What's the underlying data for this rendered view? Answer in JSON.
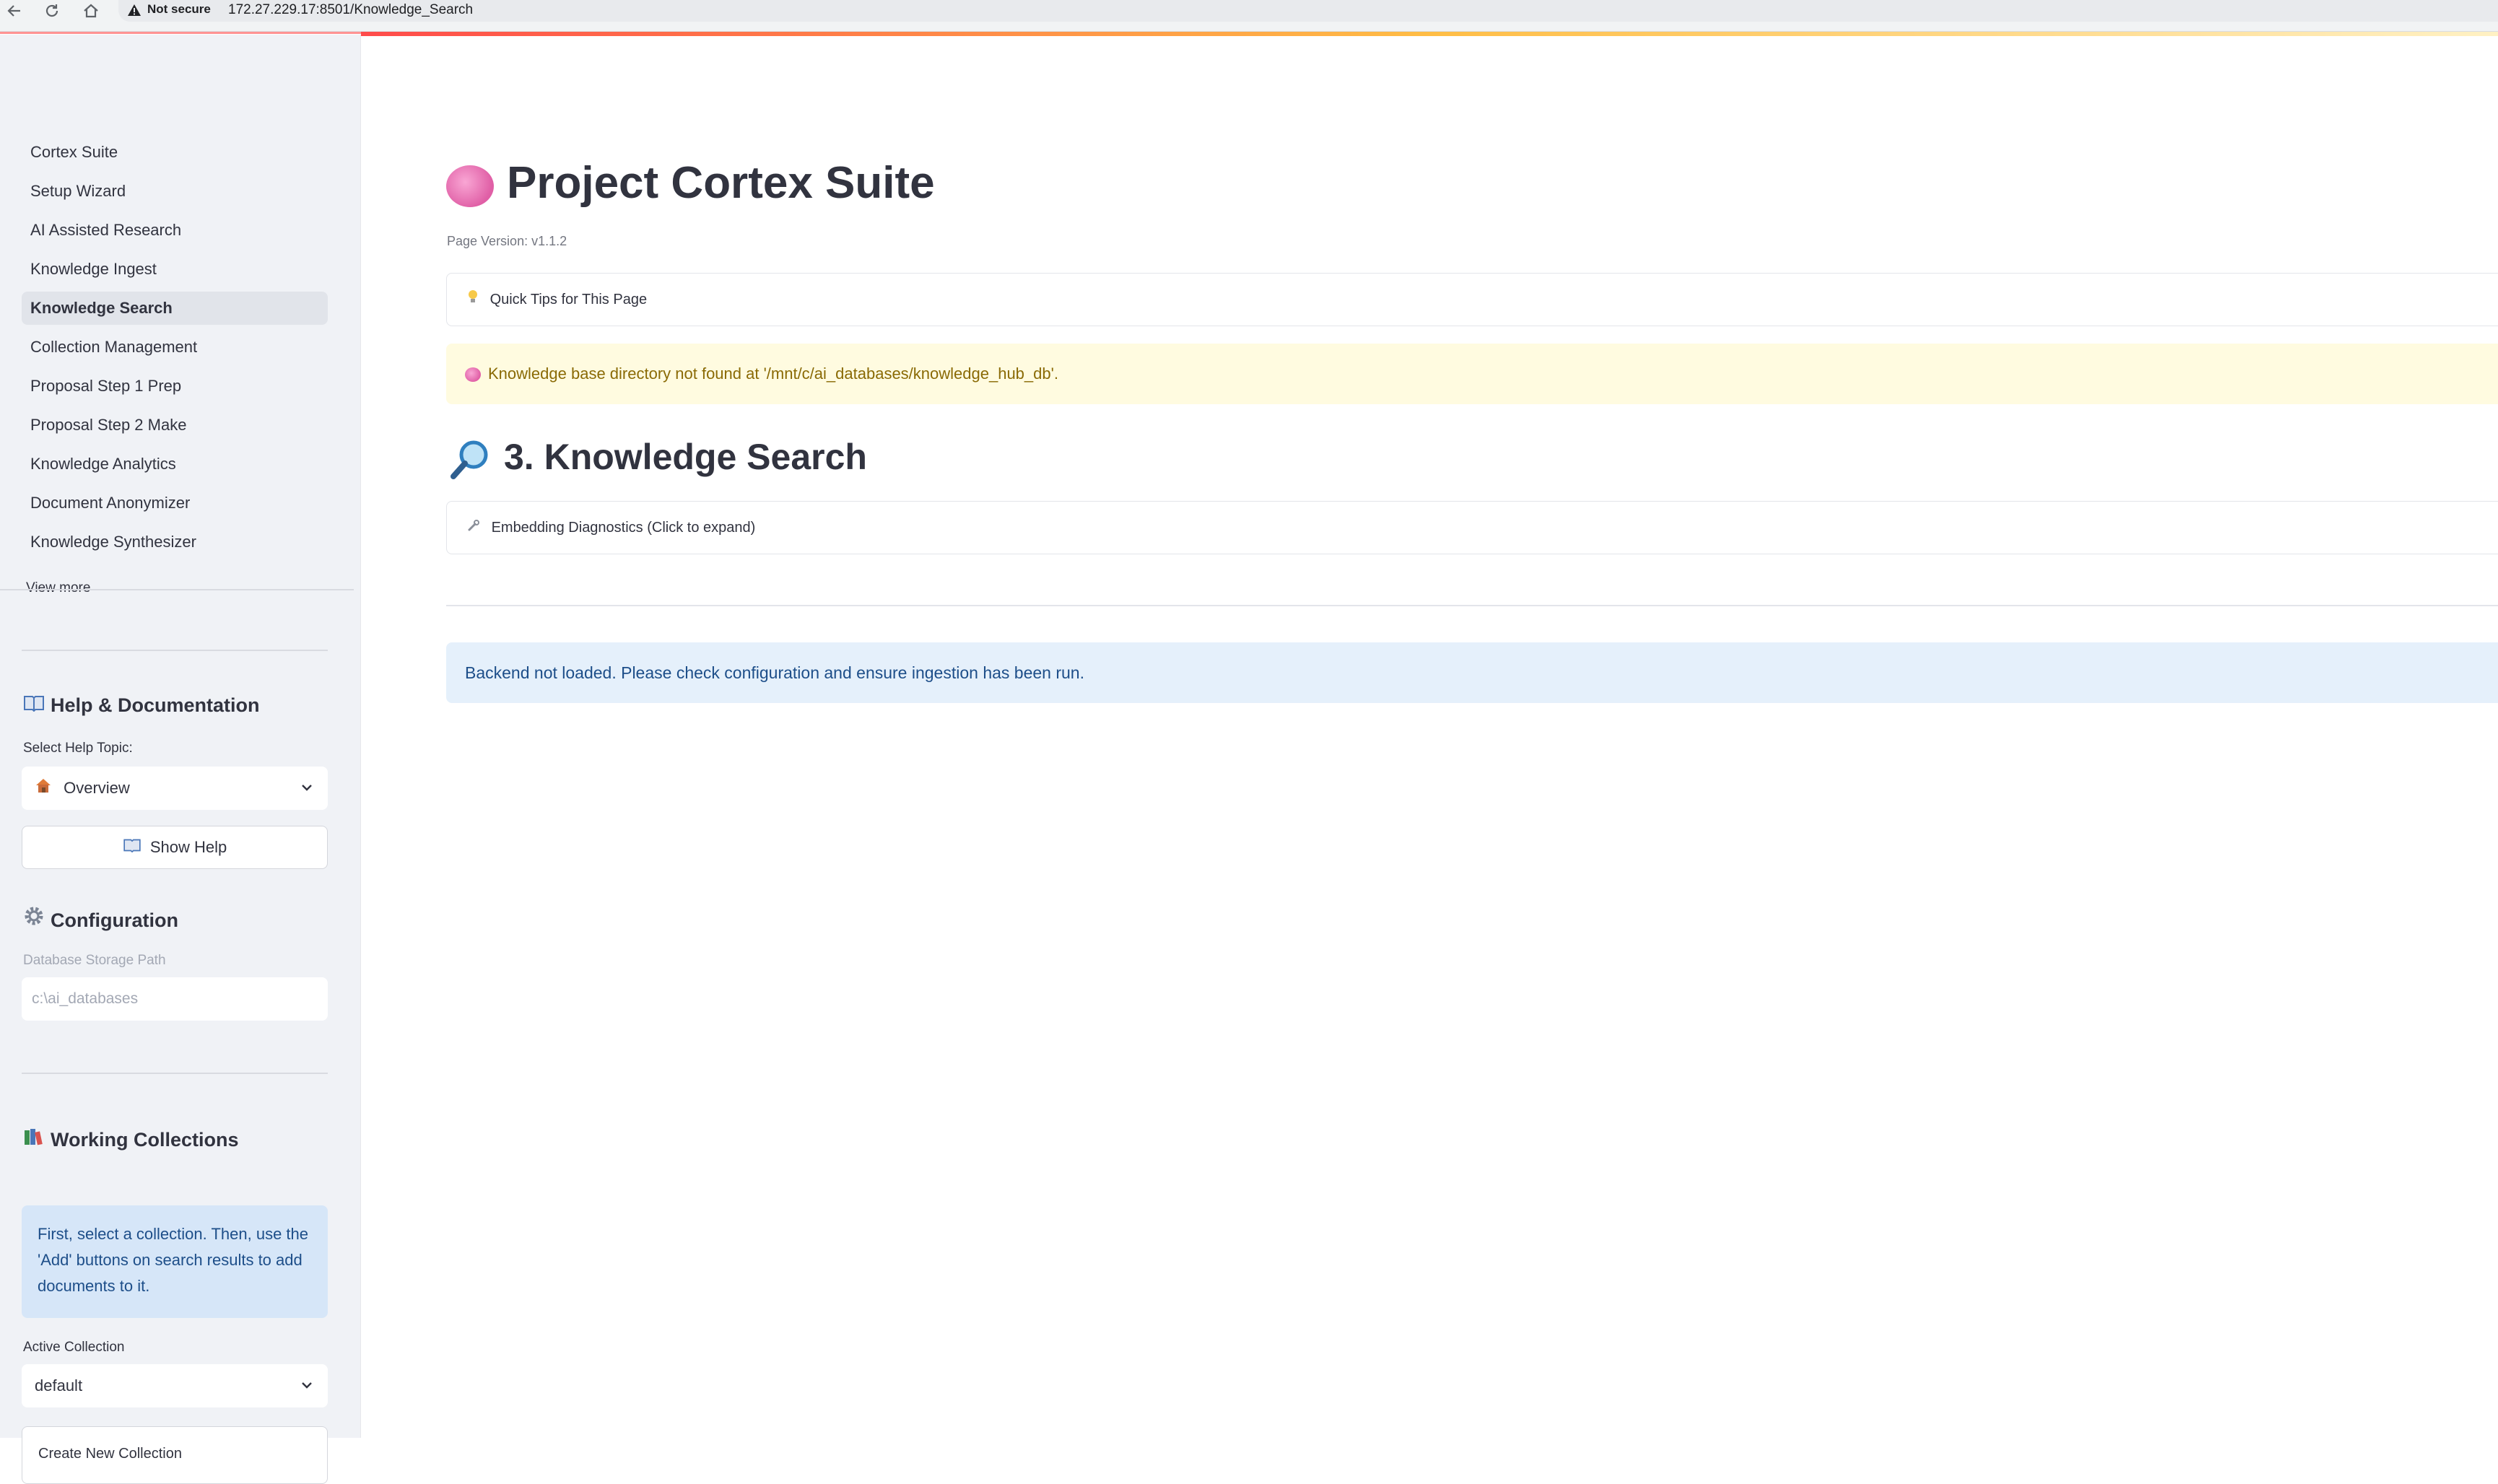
{
  "browser": {
    "security_label": "Not secure",
    "url": "172.27.229.17:8501/Knowledge_Search"
  },
  "sidebar": {
    "nav_items": [
      {
        "label": "Cortex Suite",
        "active": false
      },
      {
        "label": "Setup Wizard",
        "active": false
      },
      {
        "label": "AI Assisted Research",
        "active": false
      },
      {
        "label": "Knowledge Ingest",
        "active": false
      },
      {
        "label": "Knowledge Search",
        "active": true
      },
      {
        "label": "Collection Management",
        "active": false
      },
      {
        "label": "Proposal Step 1 Prep",
        "active": false
      },
      {
        "label": "Proposal Step 2 Make",
        "active": false
      },
      {
        "label": "Knowledge Analytics",
        "active": false
      },
      {
        "label": "Document Anonymizer",
        "active": false
      },
      {
        "label": "Knowledge Synthesizer",
        "active": false
      }
    ],
    "view_more": "View more",
    "help": {
      "heading": "Help & Documentation",
      "topic_label": "Select Help Topic:",
      "topic_value": "Overview",
      "show_help_label": "Show Help"
    },
    "config": {
      "heading": "Configuration",
      "db_path_label": "Database Storage Path",
      "db_path_placeholder": "c:\\ai_databases"
    },
    "collections": {
      "heading": "Working Collections",
      "info": "First, select a collection. Then, use the 'Add' buttons on search results to add documents to it.",
      "active_label": "Active Collection",
      "active_value": "default",
      "create_label": "Create New Collection"
    }
  },
  "main": {
    "title": "Project Cortex Suite",
    "version": "Page Version: v1.1.2",
    "quick_tips": "Quick Tips for This Page",
    "warning": "Knowledge base directory not found at '/mnt/c/ai_databases/knowledge_hub_db'.",
    "section_title": "3. Knowledge Search",
    "diagnostics": "Embedding Diagnostics (Click to expand)",
    "backend_info": "Backend not loaded. Please check configuration and ensure ingestion has been run."
  },
  "colors": {
    "accent": "#ff4b4b",
    "sidebar_bg": "#f0f2f6",
    "warning_bg": "#fffbe0",
    "info_bg": "#e5f0fb"
  }
}
